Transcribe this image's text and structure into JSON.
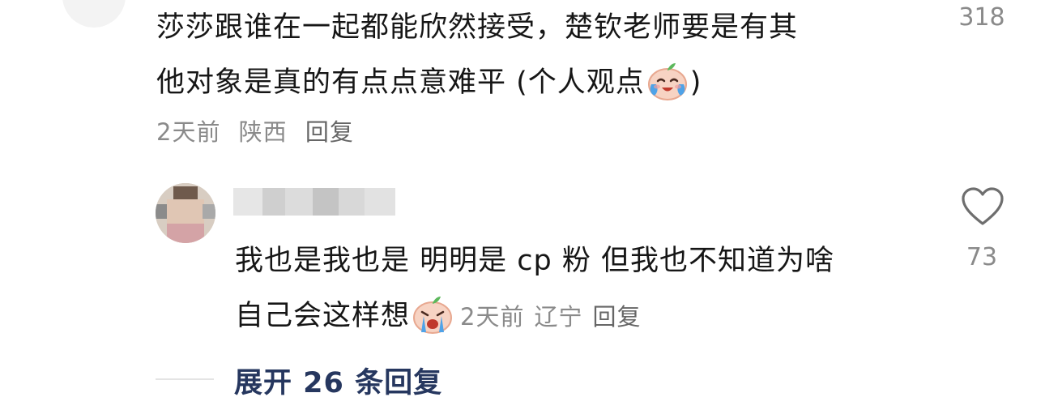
{
  "top_comment": {
    "text_line1": "莎莎跟谁在一起都能欣然接受，楚钦老师要是有其",
    "text_line2": "他对象是真的有点点意难平 (个人观点",
    "text_line2_end": ")",
    "emoji": "crying-laughing-peach-emoji",
    "time": "2天前",
    "location": "陕西",
    "reply_label": "回复",
    "like_count": "318"
  },
  "reply_comment": {
    "text_line1": "我也是我也是 明明是 cp 粉 但我也不知道为啥",
    "text_line2": "自己会这样想",
    "emoji": "crying-peach-emoji",
    "time": "2天前",
    "location": "辽宁",
    "reply_label": "回复",
    "like_count": "73",
    "like_icon": "heart-outline-icon"
  },
  "expand": {
    "label": "展开 26 条回复"
  },
  "colors": {
    "text": "#161616",
    "meta": "#8a8a8a",
    "link": "#26375f",
    "divider": "#e4e4e4"
  }
}
